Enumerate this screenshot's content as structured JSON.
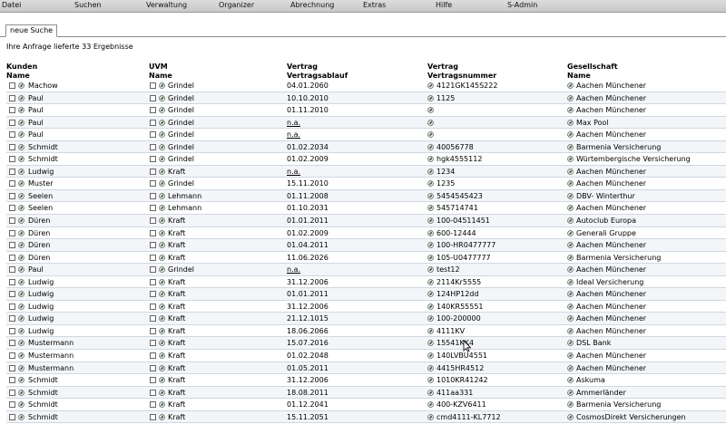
{
  "menu": [
    "Datei",
    "Suchen",
    "Verwaltung",
    "Organizer",
    "Abrechnung",
    "Extras",
    "Hilfe",
    "S-Admin"
  ],
  "tab": {
    "label": "neue Suche"
  },
  "result_text": "Ihre Anfrage lieferte 33 Ergebnisse",
  "headers": {
    "kunden": {
      "top": "Kunden",
      "sub": "Name"
    },
    "uvm": {
      "top": "UVM",
      "sub": "Name"
    },
    "ablauf": {
      "top": "Vertrag",
      "sub": "Vertragsablauf"
    },
    "nummer": {
      "top": "Vertrag",
      "sub": "Vertragsnummer"
    },
    "gesellschaft": {
      "top": "Gesellschaft",
      "sub": "Name"
    }
  },
  "rows": [
    {
      "kunde": "Machow",
      "uvm": "Grindel",
      "ablauf": "04.01.2060",
      "nummer": "4121GK145S222",
      "gesellschaft": "Aachen Münchener"
    },
    {
      "kunde": "Paul",
      "uvm": "Grindel",
      "ablauf": "10.10.2010",
      "nummer": "1125",
      "gesellschaft": "Aachen Münchener"
    },
    {
      "kunde": "Paul",
      "uvm": "Grindel",
      "ablauf": "01.11.2010",
      "nummer": "",
      "gesellschaft": "Aachen Münchener"
    },
    {
      "kunde": "Paul",
      "uvm": "Grindel",
      "ablauf": "n.a.",
      "nummer": "",
      "gesellschaft": "Max Pool"
    },
    {
      "kunde": "Paul",
      "uvm": "Grindel",
      "ablauf": "n.a.",
      "nummer": "",
      "gesellschaft": "Aachen Münchener"
    },
    {
      "kunde": "Schmidt",
      "uvm": "Grindel",
      "ablauf": "01.02.2034",
      "nummer": "40056778",
      "gesellschaft": "Barmenia Versicherung"
    },
    {
      "kunde": "Schmidt",
      "uvm": "Grindel",
      "ablauf": "01.02.2009",
      "nummer": "hgk4555112",
      "gesellschaft": "Würtembergische Versicherung"
    },
    {
      "kunde": "Ludwig",
      "uvm": "Kraft",
      "ablauf": "n.a.",
      "nummer": "1234",
      "gesellschaft": "Aachen Münchener"
    },
    {
      "kunde": "Muster",
      "uvm": "Grindel",
      "ablauf": "15.11.2010",
      "nummer": "1235",
      "gesellschaft": "Aachen Münchener"
    },
    {
      "kunde": "Seelen",
      "uvm": "Lehmann",
      "ablauf": "01.11.2008",
      "nummer": "5454545423",
      "gesellschaft": "DBV- Winterthur"
    },
    {
      "kunde": "Seelen",
      "uvm": "Lehmann",
      "ablauf": "01.10.2031",
      "nummer": "545714741",
      "gesellschaft": "Aachen Münchener"
    },
    {
      "kunde": "Düren",
      "uvm": "Kraft",
      "ablauf": "01.01.2011",
      "nummer": "100-04511451",
      "gesellschaft": "Autoclub Europa"
    },
    {
      "kunde": "Düren",
      "uvm": "Kraft",
      "ablauf": "01.02.2009",
      "nummer": "600-12444",
      "gesellschaft": "Generali Gruppe"
    },
    {
      "kunde": "Düren",
      "uvm": "Kraft",
      "ablauf": "01.04.2011",
      "nummer": "100-HR0477777",
      "gesellschaft": "Aachen Münchener"
    },
    {
      "kunde": "Düren",
      "uvm": "Kraft",
      "ablauf": "11.06.2026",
      "nummer": "105-U0477777",
      "gesellschaft": "Barmenia Versicherung"
    },
    {
      "kunde": "Paul",
      "uvm": "Grindel",
      "ablauf": "n.a.",
      "nummer": "test12",
      "gesellschaft": "Aachen Münchener"
    },
    {
      "kunde": "Ludwig",
      "uvm": "Kraft",
      "ablauf": "31.12.2006",
      "nummer": "2114Kr5555",
      "gesellschaft": "Ideal Versicherung"
    },
    {
      "kunde": "Ludwig",
      "uvm": "Kraft",
      "ablauf": "01.01.2011",
      "nummer": "124HP12dd",
      "gesellschaft": "Aachen Münchener"
    },
    {
      "kunde": "Ludwig",
      "uvm": "Kraft",
      "ablauf": "31.12.2006",
      "nummer": "140KR55551",
      "gesellschaft": "Aachen Münchener"
    },
    {
      "kunde": "Ludwig",
      "uvm": "Kraft",
      "ablauf": "21.12.1015",
      "nummer": "100-200000",
      "gesellschaft": "Aachen Münchener"
    },
    {
      "kunde": "Ludwig",
      "uvm": "Kraft",
      "ablauf": "18.06.2066",
      "nummer": "4111KV",
      "gesellschaft": "Aachen Münchener"
    },
    {
      "kunde": "Mustermann",
      "uvm": "Kraft",
      "ablauf": "15.07.2016",
      "nummer": "15541KK4",
      "gesellschaft": "DSL Bank"
    },
    {
      "kunde": "Mustermann",
      "uvm": "Kraft",
      "ablauf": "01.02.2048",
      "nummer": "140LVBU4551",
      "gesellschaft": "Aachen Münchener"
    },
    {
      "kunde": "Mustermann",
      "uvm": "Kraft",
      "ablauf": "01.05.2011",
      "nummer": "4415HR4512",
      "gesellschaft": "Aachen Münchener"
    },
    {
      "kunde": "Schmidt",
      "uvm": "Kraft",
      "ablauf": "31.12.2006",
      "nummer": "1010KR41242",
      "gesellschaft": "Askuma"
    },
    {
      "kunde": "Schmidt",
      "uvm": "Kraft",
      "ablauf": "18.08.2011",
      "nummer": "411aa331",
      "gesellschaft": "Ammerländer"
    },
    {
      "kunde": "Schmidt",
      "uvm": "Kraft",
      "ablauf": "01.12.2041",
      "nummer": "400-KZV6411",
      "gesellschaft": "Barmenia Versicherung"
    },
    {
      "kunde": "Schmidt",
      "uvm": "Kraft",
      "ablauf": "15.11.2051",
      "nummer": "cmd4111-KL7712",
      "gesellschaft": "CosmosDirekt Versicherungen"
    }
  ],
  "colors": {
    "row_border": "#cfd8e0",
    "menubar": "#d0d0d0"
  },
  "icons": {
    "row_icon": "link-icon",
    "checkbox": "checkbox-icon",
    "cursor": "mouse-cursor-icon"
  }
}
